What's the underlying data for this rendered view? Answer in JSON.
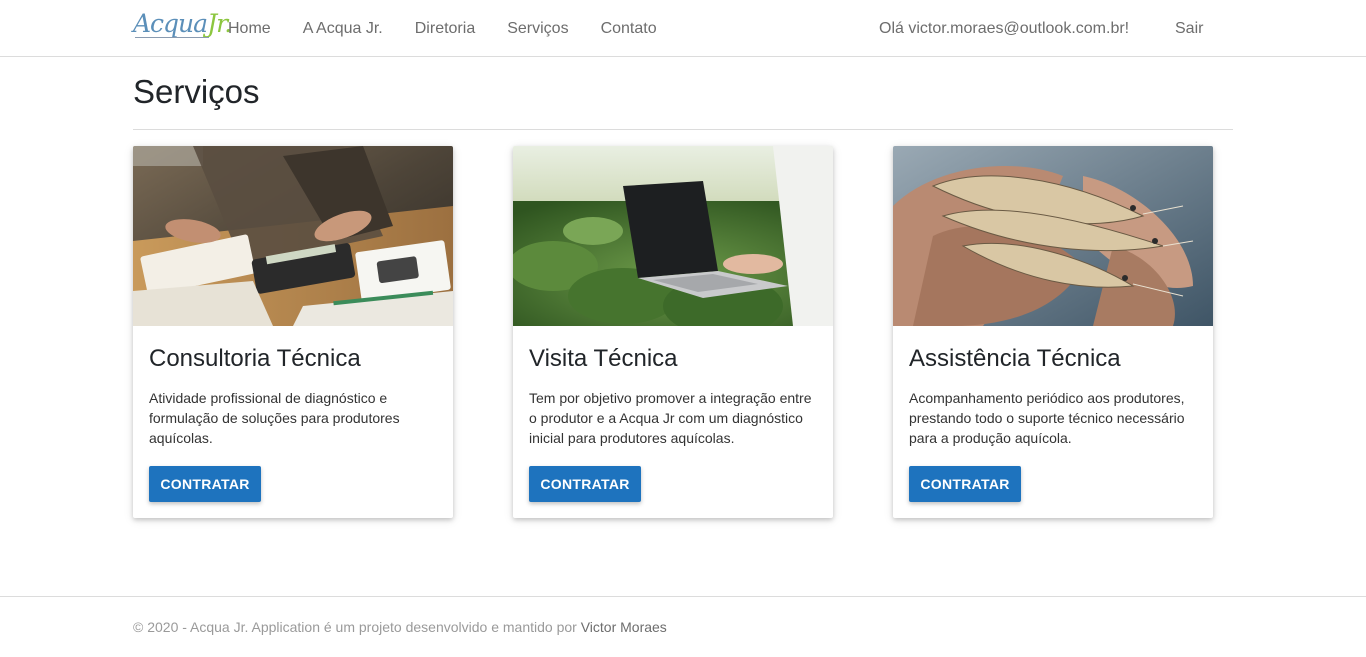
{
  "navbar": {
    "brand": {
      "word": "Acqua",
      "jr": "Jr."
    },
    "links": [
      "Home",
      "A Acqua Jr.",
      "Diretoria",
      "Serviços",
      "Contato"
    ],
    "greeting": "Olá victor.moraes@outlook.com.br!",
    "logout_label": "Sair"
  },
  "page": {
    "title": "Serviços"
  },
  "cards": [
    {
      "title": "Consultoria Técnica",
      "text": "Atividade profissional de diagnóstico e formulação de soluções para produtores aquícolas.",
      "button_label": "CONTRATAR",
      "image": "office-calculator-photo"
    },
    {
      "title": "Visita Técnica",
      "text": "Tem por objetivo promover a integração entre o produtor e a Acqua Jr com um diagnóstico inicial para produtores aquícolas.",
      "button_label": "CONTRATAR",
      "image": "laptop-in-field-photo"
    },
    {
      "title": "Assistência Técnica",
      "text": "Acompanhamento periódico aos produtores, prestando todo o suporte técnico necessário para a produção aquícola.",
      "button_label": "CONTRATAR",
      "image": "shrimp-in-hands-photo"
    }
  ],
  "footer": {
    "text": "© 2020 - Acqua Jr. Application é um projeto desenvolvido e mantido por",
    "author": "Victor Moraes"
  },
  "colors": {
    "primary_button": "#1e73be",
    "nav_text": "#6d6d6d",
    "logo_blue": "#5b8fb9",
    "logo_green": "#8cc63f"
  }
}
